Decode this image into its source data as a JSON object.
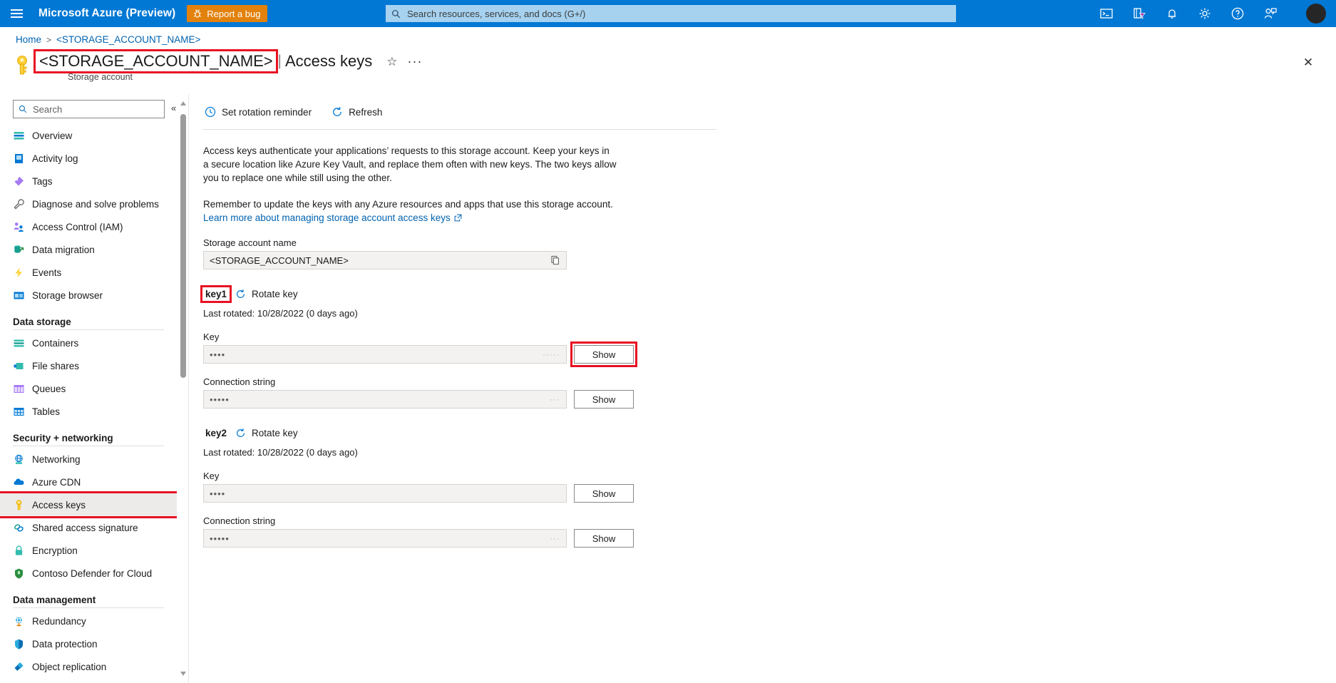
{
  "topbar": {
    "menu_icon": "hamburger-icon",
    "brand": "Microsoft Azure (Preview)",
    "report_bug_label": "Report a bug",
    "report_bug_color": "#e2810c",
    "search_placeholder": "Search resources, services, and docs (G+/)",
    "search_value": "",
    "icons": [
      "cloud-shell-icon",
      "directories-filter-icon",
      "notifications-bell-icon",
      "settings-gear-icon",
      "help-question-icon",
      "feedback-smiley-icon"
    ],
    "avatar": "user-avatar"
  },
  "breadcrumb": {
    "home": "Home",
    "separator": ">",
    "current": "<STORAGE_ACCOUNT_NAME>"
  },
  "header": {
    "resource_name": "<STORAGE_ACCOUNT_NAME>",
    "pipe": "|",
    "page": "Access keys",
    "subtitle": "Storage account",
    "star_glyph": "☆",
    "ellipsis_glyph": "···",
    "close_glyph": "✕",
    "highlight_color": "#e81123"
  },
  "leftnav": {
    "search_placeholder": "Search",
    "search_value": "",
    "collapse_glyph": "«",
    "items": [
      {
        "label": "Overview",
        "icon": "overview-icon",
        "type": "item"
      },
      {
        "label": "Activity log",
        "icon": "activity-log-icon",
        "type": "item"
      },
      {
        "label": "Tags",
        "icon": "tags-icon",
        "type": "item"
      },
      {
        "label": "Diagnose and solve problems",
        "icon": "diagnose-wrench-icon",
        "type": "item"
      },
      {
        "label": "Access Control (IAM)",
        "icon": "access-control-users-icon",
        "type": "item"
      },
      {
        "label": "Data migration",
        "icon": "data-migration-icon",
        "type": "item"
      },
      {
        "label": "Events",
        "icon": "events-lightning-icon",
        "type": "item"
      },
      {
        "label": "Storage browser",
        "icon": "storage-browser-icon",
        "type": "item"
      },
      {
        "label": "Data storage",
        "type": "group"
      },
      {
        "label": "Containers",
        "icon": "containers-icon",
        "type": "item"
      },
      {
        "label": "File shares",
        "icon": "file-shares-icon",
        "type": "item"
      },
      {
        "label": "Queues",
        "icon": "queues-icon",
        "type": "item"
      },
      {
        "label": "Tables",
        "icon": "tables-icon",
        "type": "item"
      },
      {
        "label": "Security + networking",
        "type": "group"
      },
      {
        "label": "Networking",
        "icon": "networking-icon",
        "type": "item"
      },
      {
        "label": "Azure CDN",
        "icon": "azure-cdn-cloud-icon",
        "type": "item"
      },
      {
        "label": "Access keys",
        "icon": "access-keys-icon",
        "type": "item",
        "selected": true,
        "highlighted": true
      },
      {
        "label": "Shared access signature",
        "icon": "shared-access-signature-icon",
        "type": "item"
      },
      {
        "label": "Encryption",
        "icon": "encryption-lock-icon",
        "type": "item"
      },
      {
        "label": "Contoso Defender for Cloud",
        "icon": "defender-shield-icon",
        "type": "item"
      },
      {
        "label": "Data management",
        "type": "group"
      },
      {
        "label": "Redundancy",
        "icon": "redundancy-globe-icon",
        "type": "item"
      },
      {
        "label": "Data protection",
        "icon": "data-protection-shield-icon",
        "type": "item"
      },
      {
        "label": "Object replication",
        "icon": "object-replication-icon",
        "type": "item"
      }
    ]
  },
  "toolbar": {
    "set_rotation_reminder": "Set rotation reminder",
    "refresh": "Refresh"
  },
  "main": {
    "paragraph1": "Access keys authenticate your applications’ requests to this storage account. Keep your keys in a secure location like Azure Key Vault, and replace them often with new keys. The two keys allow you to replace one while still using the other.",
    "paragraph2": "Remember to update the keys with any Azure resources and apps that use this storage account.",
    "learn_more": "Learn more about managing storage account access keys",
    "storage_account_name_label": "Storage account name",
    "storage_account_name_value": "<STORAGE_ACCOUNT_NAME>",
    "keys": [
      {
        "name": "key1",
        "rotate_label": "Rotate key",
        "last_rotated": "Last rotated: 10/28/2022 (0 days ago)",
        "key_label": "Key",
        "key_value": "••••",
        "key_show_label": "Show",
        "key_show_highlighted": true,
        "name_highlighted": true,
        "conn_label": "Connection string",
        "conn_value": "•••••",
        "conn_show_label": "Show"
      },
      {
        "name": "key2",
        "rotate_label": "Rotate key",
        "last_rotated": "Last rotated: 10/28/2022 (0 days ago)",
        "key_label": "Key",
        "key_value": "••••",
        "key_show_label": "Show",
        "key_show_highlighted": false,
        "name_highlighted": false,
        "conn_label": "Connection string",
        "conn_value": "•••••",
        "conn_show_label": "Show"
      }
    ]
  }
}
